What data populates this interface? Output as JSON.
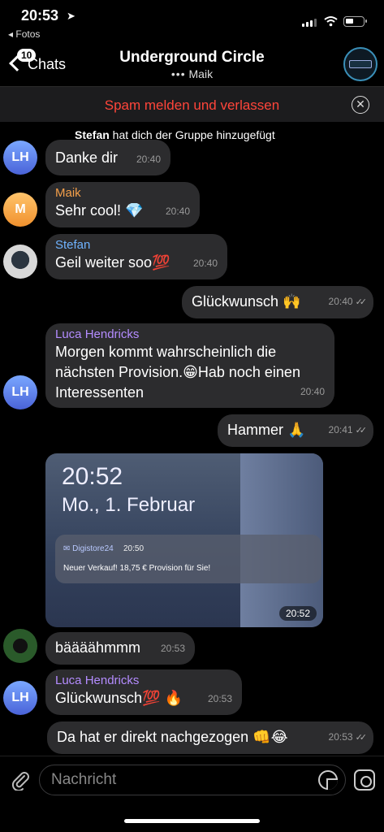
{
  "status_bar": {
    "time": "20:53",
    "back_app": "◂ Fotos"
  },
  "header": {
    "back_badge": "10",
    "back_label": "Chats",
    "title": "Underground Circle",
    "subtitle_dots": "•••",
    "subtitle": "Maik"
  },
  "spam_bar": {
    "label": "Spam melden und verlassen",
    "close": "✕"
  },
  "service_message": {
    "actor": "Stefan",
    "text": " hat dich der Gruppe hinzugefügt"
  },
  "messages": [
    {
      "sender": "Luca Hendricks",
      "text": "Danke dir",
      "time": "20:40"
    },
    {
      "sender": "Maik",
      "text": "Sehr cool! 💎",
      "time": "20:40",
      "sender_color": "#f5a04a"
    },
    {
      "sender": "Stefan",
      "text": "Geil weiter soo💯",
      "time": "20:40",
      "sender_color": "#6fb3ff"
    },
    {
      "text": "Glückwunsch 🙌",
      "time": "20:40"
    },
    {
      "sender": "Luca Hendricks",
      "lines": [
        "Morgen kommt wahrscheinlich die",
        "nächsten Provision.😁Hab noch einen",
        "Interessenten"
      ],
      "time": "20:40"
    },
    {
      "text": "Hammer 🙏",
      "time": "20:41"
    },
    {
      "photo_time": "20:52",
      "photo_date": "Mo., 1. Februar",
      "notif_app": "✉ Digistore24",
      "notif_time": "20:50",
      "notif_body": "Neuer Verkauf! 18,75 € Provision für Sie!",
      "time": "20:52"
    },
    {
      "text": "bääääh​mmm",
      "time": "20:53"
    },
    {
      "sender": "Luca Hendricks",
      "text": "Glückwunsch💯 🔥",
      "time": "20:53"
    },
    {
      "text": "Da hat er direkt nachgezogen 👊😂",
      "time": "20:53"
    }
  ],
  "avatars": {
    "luca": "LH",
    "maik": "M"
  },
  "colors": {
    "luca_sender": "#b48cff",
    "maik_sender": "#f5a04a",
    "stefan_sender": "#6fb3ff",
    "spam": "#ff453a"
  },
  "input": {
    "placeholder": "Nachricht"
  },
  "icons": [
    "navigation-arrow-icon",
    "signal-icon",
    "wifi-icon",
    "battery-icon",
    "back-chevron-icon",
    "attach-icon",
    "sticker-icon",
    "camera-icon",
    "read-ticks-icon"
  ]
}
